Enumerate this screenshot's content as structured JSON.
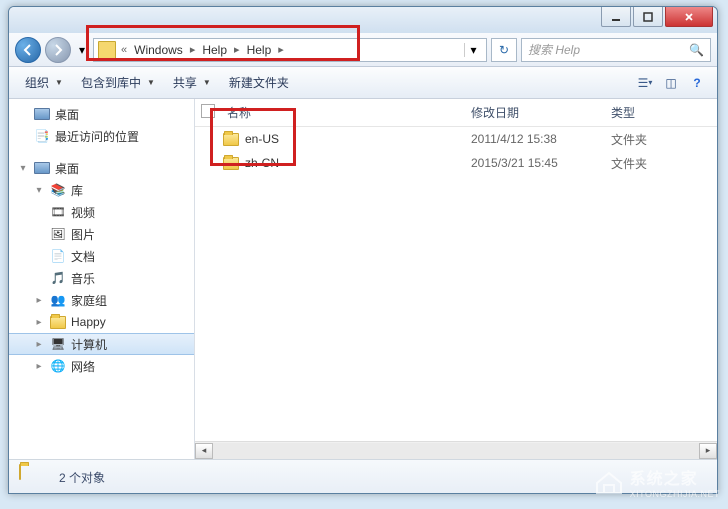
{
  "titlebar": {
    "close": "✕"
  },
  "address": {
    "prefix": "«",
    "segs": [
      "Windows",
      "Help",
      "Help"
    ]
  },
  "search": {
    "placeholder": "搜索 Help"
  },
  "toolbar": {
    "org": "组织",
    "include": "包含到库中",
    "share": "共享",
    "newfolder": "新建文件夹"
  },
  "tree": {
    "fav_desktop": "桌面",
    "fav_recent": "最近访问的位置",
    "desktop": "桌面",
    "library": "库",
    "videos": "视频",
    "pictures": "图片",
    "docs": "文档",
    "music": "音乐",
    "homegroup": "家庭组",
    "happy": "Happy",
    "computer": "计算机",
    "network": "网络"
  },
  "columns": {
    "name": "名称",
    "date": "修改日期",
    "type": "类型"
  },
  "files": [
    {
      "name": "en-US",
      "date": "2011/4/12 15:38",
      "type": "文件夹"
    },
    {
      "name": "zh-CN",
      "date": "2015/3/21 15:45",
      "type": "文件夹"
    }
  ],
  "status": {
    "text": "2 个对象"
  },
  "watermark": {
    "line1": "系统之家",
    "line2": "XITONGZHIJIA.NET"
  }
}
